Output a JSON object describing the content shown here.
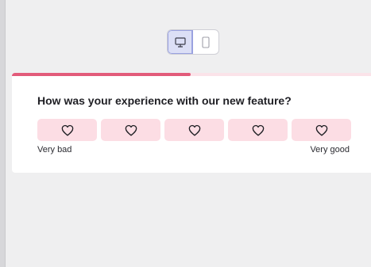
{
  "device_toggle": {
    "desktop_icon": "desktop-icon",
    "mobile_icon": "mobile-icon",
    "selected": "desktop"
  },
  "survey": {
    "progress": 0.49,
    "question": "How was your experience with our new feature?",
    "rating_icon": "heart-outline-icon",
    "options_count": 5,
    "low_label": "Very bad",
    "high_label": "Very good"
  },
  "colors": {
    "accent": "#e25b7a",
    "option_bg": "#fcdde4",
    "progress_track": "#fbe3e9",
    "toggle_active_bg": "#dcdff6"
  }
}
